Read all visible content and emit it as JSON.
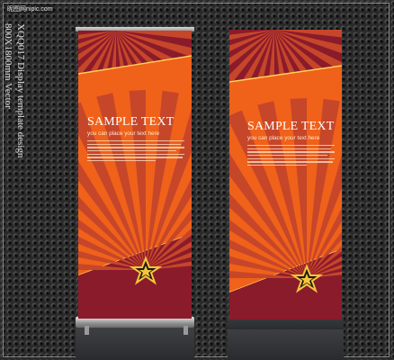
{
  "watermark": "昵图网nipic.com",
  "side_text": {
    "line1": "XQQ017 Display template design",
    "line2": "800X1800mm Vector"
  },
  "banners": [
    {
      "title": "SAMPLE TEXT",
      "subtitle": "you can place your text here",
      "colors": {
        "main": "#f0611a",
        "dark": "#8a1b2b",
        "ray": "#c6462a",
        "stripe": "#ffd15a",
        "star": "#f6c63a"
      }
    },
    {
      "title": "SAMPLE TEXT",
      "subtitle": "you can place your text here",
      "colors": {
        "main": "#f0611a",
        "dark": "#8a1b2b",
        "ray": "#c6462a",
        "stripe": "#ffd15a",
        "star": "#f6c63a"
      }
    }
  ]
}
